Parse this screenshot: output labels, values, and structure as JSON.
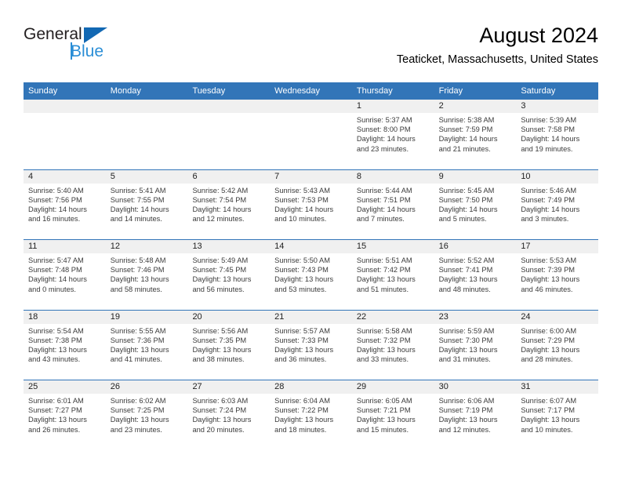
{
  "brand": {
    "name_part1": "General",
    "name_part2": "Blue",
    "logo_icon": "triangle-logo"
  },
  "header": {
    "title": "August 2024",
    "subtitle": "Teaticket, Massachusetts, United States"
  },
  "colors": {
    "header_blue": "#3275b8",
    "brand_blue": "#2b8ed6",
    "logo_triangle": "#1268b3",
    "day_band_gray": "#f0f0f0",
    "body_text": "#3b3b3b"
  },
  "calendar": {
    "weekday_headers": [
      "Sunday",
      "Monday",
      "Tuesday",
      "Wednesday",
      "Thursday",
      "Friday",
      "Saturday"
    ],
    "weeks": [
      [
        {
          "day": "",
          "sunrise": "",
          "sunset": "",
          "daylight_line1": "",
          "daylight_line2": ""
        },
        {
          "day": "",
          "sunrise": "",
          "sunset": "",
          "daylight_line1": "",
          "daylight_line2": ""
        },
        {
          "day": "",
          "sunrise": "",
          "sunset": "",
          "daylight_line1": "",
          "daylight_line2": ""
        },
        {
          "day": "",
          "sunrise": "",
          "sunset": "",
          "daylight_line1": "",
          "daylight_line2": ""
        },
        {
          "day": "1",
          "sunrise": "Sunrise: 5:37 AM",
          "sunset": "Sunset: 8:00 PM",
          "daylight_line1": "Daylight: 14 hours",
          "daylight_line2": "and 23 minutes."
        },
        {
          "day": "2",
          "sunrise": "Sunrise: 5:38 AM",
          "sunset": "Sunset: 7:59 PM",
          "daylight_line1": "Daylight: 14 hours",
          "daylight_line2": "and 21 minutes."
        },
        {
          "day": "3",
          "sunrise": "Sunrise: 5:39 AM",
          "sunset": "Sunset: 7:58 PM",
          "daylight_line1": "Daylight: 14 hours",
          "daylight_line2": "and 19 minutes."
        }
      ],
      [
        {
          "day": "4",
          "sunrise": "Sunrise: 5:40 AM",
          "sunset": "Sunset: 7:56 PM",
          "daylight_line1": "Daylight: 14 hours",
          "daylight_line2": "and 16 minutes."
        },
        {
          "day": "5",
          "sunrise": "Sunrise: 5:41 AM",
          "sunset": "Sunset: 7:55 PM",
          "daylight_line1": "Daylight: 14 hours",
          "daylight_line2": "and 14 minutes."
        },
        {
          "day": "6",
          "sunrise": "Sunrise: 5:42 AM",
          "sunset": "Sunset: 7:54 PM",
          "daylight_line1": "Daylight: 14 hours",
          "daylight_line2": "and 12 minutes."
        },
        {
          "day": "7",
          "sunrise": "Sunrise: 5:43 AM",
          "sunset": "Sunset: 7:53 PM",
          "daylight_line1": "Daylight: 14 hours",
          "daylight_line2": "and 10 minutes."
        },
        {
          "day": "8",
          "sunrise": "Sunrise: 5:44 AM",
          "sunset": "Sunset: 7:51 PM",
          "daylight_line1": "Daylight: 14 hours",
          "daylight_line2": "and 7 minutes."
        },
        {
          "day": "9",
          "sunrise": "Sunrise: 5:45 AM",
          "sunset": "Sunset: 7:50 PM",
          "daylight_line1": "Daylight: 14 hours",
          "daylight_line2": "and 5 minutes."
        },
        {
          "day": "10",
          "sunrise": "Sunrise: 5:46 AM",
          "sunset": "Sunset: 7:49 PM",
          "daylight_line1": "Daylight: 14 hours",
          "daylight_line2": "and 3 minutes."
        }
      ],
      [
        {
          "day": "11",
          "sunrise": "Sunrise: 5:47 AM",
          "sunset": "Sunset: 7:48 PM",
          "daylight_line1": "Daylight: 14 hours",
          "daylight_line2": "and 0 minutes."
        },
        {
          "day": "12",
          "sunrise": "Sunrise: 5:48 AM",
          "sunset": "Sunset: 7:46 PM",
          "daylight_line1": "Daylight: 13 hours",
          "daylight_line2": "and 58 minutes."
        },
        {
          "day": "13",
          "sunrise": "Sunrise: 5:49 AM",
          "sunset": "Sunset: 7:45 PM",
          "daylight_line1": "Daylight: 13 hours",
          "daylight_line2": "and 56 minutes."
        },
        {
          "day": "14",
          "sunrise": "Sunrise: 5:50 AM",
          "sunset": "Sunset: 7:43 PM",
          "daylight_line1": "Daylight: 13 hours",
          "daylight_line2": "and 53 minutes."
        },
        {
          "day": "15",
          "sunrise": "Sunrise: 5:51 AM",
          "sunset": "Sunset: 7:42 PM",
          "daylight_line1": "Daylight: 13 hours",
          "daylight_line2": "and 51 minutes."
        },
        {
          "day": "16",
          "sunrise": "Sunrise: 5:52 AM",
          "sunset": "Sunset: 7:41 PM",
          "daylight_line1": "Daylight: 13 hours",
          "daylight_line2": "and 48 minutes."
        },
        {
          "day": "17",
          "sunrise": "Sunrise: 5:53 AM",
          "sunset": "Sunset: 7:39 PM",
          "daylight_line1": "Daylight: 13 hours",
          "daylight_line2": "and 46 minutes."
        }
      ],
      [
        {
          "day": "18",
          "sunrise": "Sunrise: 5:54 AM",
          "sunset": "Sunset: 7:38 PM",
          "daylight_line1": "Daylight: 13 hours",
          "daylight_line2": "and 43 minutes."
        },
        {
          "day": "19",
          "sunrise": "Sunrise: 5:55 AM",
          "sunset": "Sunset: 7:36 PM",
          "daylight_line1": "Daylight: 13 hours",
          "daylight_line2": "and 41 minutes."
        },
        {
          "day": "20",
          "sunrise": "Sunrise: 5:56 AM",
          "sunset": "Sunset: 7:35 PM",
          "daylight_line1": "Daylight: 13 hours",
          "daylight_line2": "and 38 minutes."
        },
        {
          "day": "21",
          "sunrise": "Sunrise: 5:57 AM",
          "sunset": "Sunset: 7:33 PM",
          "daylight_line1": "Daylight: 13 hours",
          "daylight_line2": "and 36 minutes."
        },
        {
          "day": "22",
          "sunrise": "Sunrise: 5:58 AM",
          "sunset": "Sunset: 7:32 PM",
          "daylight_line1": "Daylight: 13 hours",
          "daylight_line2": "and 33 minutes."
        },
        {
          "day": "23",
          "sunrise": "Sunrise: 5:59 AM",
          "sunset": "Sunset: 7:30 PM",
          "daylight_line1": "Daylight: 13 hours",
          "daylight_line2": "and 31 minutes."
        },
        {
          "day": "24",
          "sunrise": "Sunrise: 6:00 AM",
          "sunset": "Sunset: 7:29 PM",
          "daylight_line1": "Daylight: 13 hours",
          "daylight_line2": "and 28 minutes."
        }
      ],
      [
        {
          "day": "25",
          "sunrise": "Sunrise: 6:01 AM",
          "sunset": "Sunset: 7:27 PM",
          "daylight_line1": "Daylight: 13 hours",
          "daylight_line2": "and 26 minutes."
        },
        {
          "day": "26",
          "sunrise": "Sunrise: 6:02 AM",
          "sunset": "Sunset: 7:25 PM",
          "daylight_line1": "Daylight: 13 hours",
          "daylight_line2": "and 23 minutes."
        },
        {
          "day": "27",
          "sunrise": "Sunrise: 6:03 AM",
          "sunset": "Sunset: 7:24 PM",
          "daylight_line1": "Daylight: 13 hours",
          "daylight_line2": "and 20 minutes."
        },
        {
          "day": "28",
          "sunrise": "Sunrise: 6:04 AM",
          "sunset": "Sunset: 7:22 PM",
          "daylight_line1": "Daylight: 13 hours",
          "daylight_line2": "and 18 minutes."
        },
        {
          "day": "29",
          "sunrise": "Sunrise: 6:05 AM",
          "sunset": "Sunset: 7:21 PM",
          "daylight_line1": "Daylight: 13 hours",
          "daylight_line2": "and 15 minutes."
        },
        {
          "day": "30",
          "sunrise": "Sunrise: 6:06 AM",
          "sunset": "Sunset: 7:19 PM",
          "daylight_line1": "Daylight: 13 hours",
          "daylight_line2": "and 12 minutes."
        },
        {
          "day": "31",
          "sunrise": "Sunrise: 6:07 AM",
          "sunset": "Sunset: 7:17 PM",
          "daylight_line1": "Daylight: 13 hours",
          "daylight_line2": "and 10 minutes."
        }
      ]
    ]
  }
}
